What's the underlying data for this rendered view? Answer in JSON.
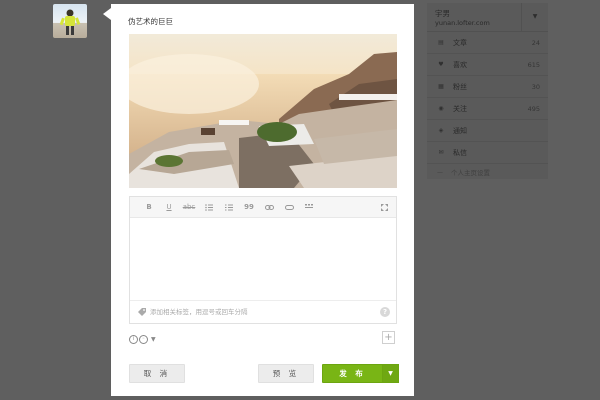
{
  "post": {
    "title": "伪艺术的巨巨",
    "photo_alt": "海边露台风景照片"
  },
  "editor": {
    "toolbar": [
      {
        "name": "bold-button",
        "label": "B"
      },
      {
        "name": "underline-button",
        "label": "U"
      },
      {
        "name": "strikethrough-button",
        "label": "abc"
      },
      {
        "name": "bullet-list-button",
        "label": ""
      },
      {
        "name": "numbered-list-button",
        "label": ""
      },
      {
        "name": "quote-button",
        "label": "99"
      },
      {
        "name": "link-button",
        "label": ""
      },
      {
        "name": "unlink-button",
        "label": ""
      },
      {
        "name": "more-button",
        "label": ""
      }
    ],
    "tags_placeholder": "添加相关标签，用逗号或回车分隔",
    "help_label": "?"
  },
  "buttons": {
    "cancel": "取 消",
    "preview": "预 览",
    "publish": "发 布"
  },
  "sidebar": {
    "username": "宇男",
    "url": "yunan.lofter.com",
    "items": [
      {
        "label": "文章",
        "count": "24",
        "icon": "article-icon"
      },
      {
        "label": "喜欢",
        "count": "615",
        "icon": "heart-icon"
      },
      {
        "label": "粉丝",
        "count": "30",
        "icon": "fans-icon"
      },
      {
        "label": "关注",
        "count": "495",
        "icon": "eye-icon"
      },
      {
        "label": "通知",
        "count": "",
        "icon": "bell-icon"
      },
      {
        "label": "私信",
        "count": "",
        "icon": "mail-icon"
      }
    ],
    "settings": "个人主页设置"
  },
  "colors": {
    "overlay": "#5f5f5f",
    "publish": "#79b515"
  }
}
